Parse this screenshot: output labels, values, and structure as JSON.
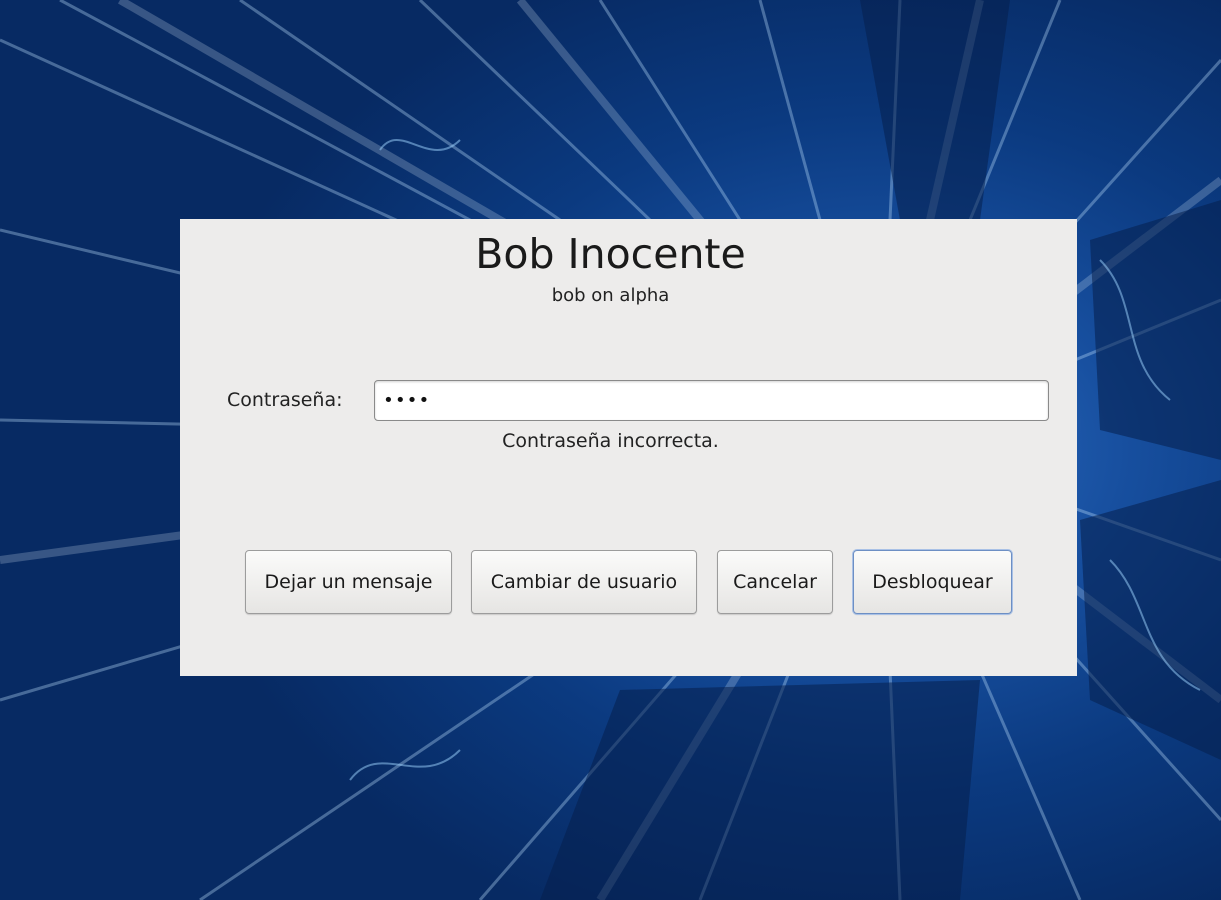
{
  "unlock_dialog": {
    "user_full_name": "Bob Inocente",
    "host_line": "bob on alpha",
    "password_label": "Contraseña:",
    "password_value": "••••",
    "error_message": "Contraseña incorrecta.",
    "buttons": {
      "leave_message": "Dejar un mensaje",
      "switch_user": "Cambiar de usuario",
      "cancel": "Cancelar",
      "unlock": "Desbloquear"
    },
    "default_button": "unlock"
  },
  "colors": {
    "dialog_background": "#edeceb",
    "wallpaper_primary": "#174f9f",
    "default_button_focus": "#6d8fc4"
  }
}
